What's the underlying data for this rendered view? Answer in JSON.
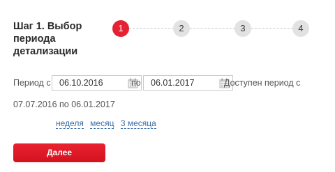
{
  "step": {
    "title": "Шаг 1. Выбор периода детализации"
  },
  "stepper": {
    "steps": [
      "1",
      "2",
      "3",
      "4"
    ],
    "active_index": 0
  },
  "period": {
    "from_label": "Период с",
    "from_value": "06.10.2016",
    "to_label": "по",
    "to_value": "06.01.2017",
    "available_line1": "Доступен период с",
    "available_line2": "07.07.2016 по 06.01.2017"
  },
  "quick_links": {
    "week": "неделя",
    "month": "месяц",
    "three_months": "3 месяца"
  },
  "actions": {
    "next_label": "Далее"
  },
  "colors": {
    "accent": "#e52233",
    "inactive_step": "#e2e2e2",
    "link": "#3a6ea8"
  }
}
